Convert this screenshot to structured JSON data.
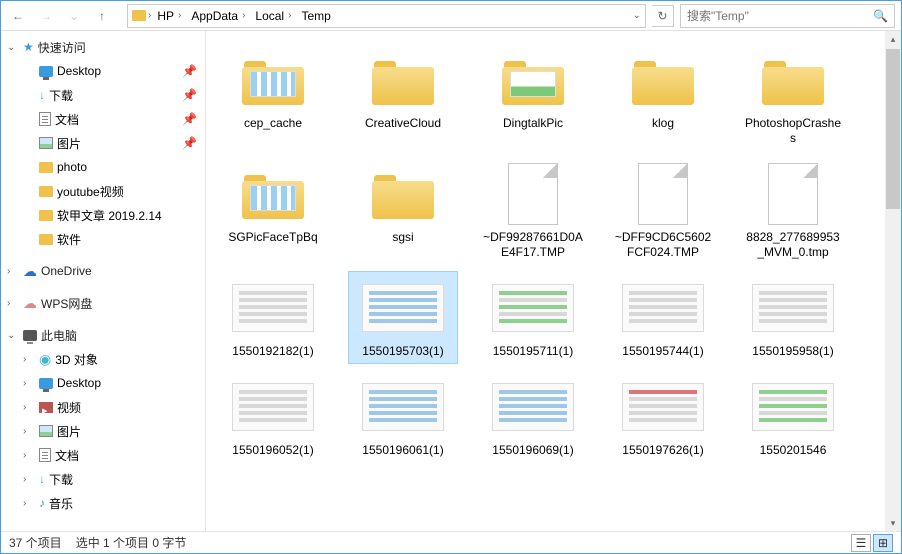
{
  "nav": {
    "back": "←",
    "forward": "→",
    "up": "↑"
  },
  "breadcrumb": [
    "HP",
    "AppData",
    "Local",
    "Temp"
  ],
  "search_placeholder": "搜索\"Temp\"",
  "sidebar": {
    "quick": {
      "label": "快速访问",
      "items": [
        {
          "label": "Desktop",
          "icon": "desk",
          "pin": true
        },
        {
          "label": "下载",
          "icon": "dl",
          "pin": true
        },
        {
          "label": "文档",
          "icon": "doc",
          "pin": true
        },
        {
          "label": "图片",
          "icon": "pic",
          "pin": true
        },
        {
          "label": "photo",
          "icon": "sfolder"
        },
        {
          "label": "youtube视频",
          "icon": "sfolder"
        },
        {
          "label": "软甲文章 2019.2.14",
          "icon": "sfolder"
        },
        {
          "label": "软件",
          "icon": "sfolder"
        }
      ]
    },
    "onedrive": "OneDrive",
    "wps": "WPS网盘",
    "pc": {
      "label": "此电脑",
      "items": [
        {
          "label": "3D 对象",
          "icon": "3d"
        },
        {
          "label": "Desktop",
          "icon": "desk"
        },
        {
          "label": "视频",
          "icon": "vid"
        },
        {
          "label": "图片",
          "icon": "pic"
        },
        {
          "label": "文档",
          "icon": "doc"
        },
        {
          "label": "下载",
          "icon": "dl"
        },
        {
          "label": "音乐",
          "icon": "music"
        }
      ]
    }
  },
  "items": [
    {
      "type": "folder-preview",
      "preview": "stripes",
      "label": "cep_cache"
    },
    {
      "type": "folder",
      "label": "CreativeCloud"
    },
    {
      "type": "folder-preview",
      "preview": "img",
      "label": "DingtalkPic"
    },
    {
      "type": "folder",
      "label": "klog"
    },
    {
      "type": "folder",
      "label": "PhotoshopCrashes"
    },
    {
      "type": "folder-preview",
      "preview": "stripes",
      "label": "SGPicFaceTpBq"
    },
    {
      "type": "folder",
      "label": "sgsi"
    },
    {
      "type": "file",
      "label": "~DF99287661D0AE4F17.TMP"
    },
    {
      "type": "file",
      "label": "~DFF9CD6C5602FCF024.TMP"
    },
    {
      "type": "file",
      "label": "8828_277689953_MVM_0.tmp"
    },
    {
      "type": "thumb",
      "variant": "",
      "label": "1550192182(1)"
    },
    {
      "type": "thumb",
      "variant": "blue",
      "label": "1550195703(1)",
      "selected": true
    },
    {
      "type": "thumb",
      "variant": "green",
      "label": "1550195711(1)"
    },
    {
      "type": "thumb",
      "variant": "",
      "label": "1550195744(1)"
    },
    {
      "type": "thumb",
      "variant": "",
      "label": "1550195958(1)"
    },
    {
      "type": "thumb",
      "variant": "",
      "label": "1550196052(1)"
    },
    {
      "type": "thumb",
      "variant": "blue",
      "label": "1550196061(1)"
    },
    {
      "type": "thumb",
      "variant": "blue",
      "label": "1550196069(1)"
    },
    {
      "type": "thumb",
      "variant": "mixed",
      "label": "1550197626(1)"
    },
    {
      "type": "thumb",
      "variant": "green",
      "label": "1550201546"
    }
  ],
  "status": {
    "count": "37 个项目",
    "selection": "选中 1 个项目  0 字节"
  }
}
